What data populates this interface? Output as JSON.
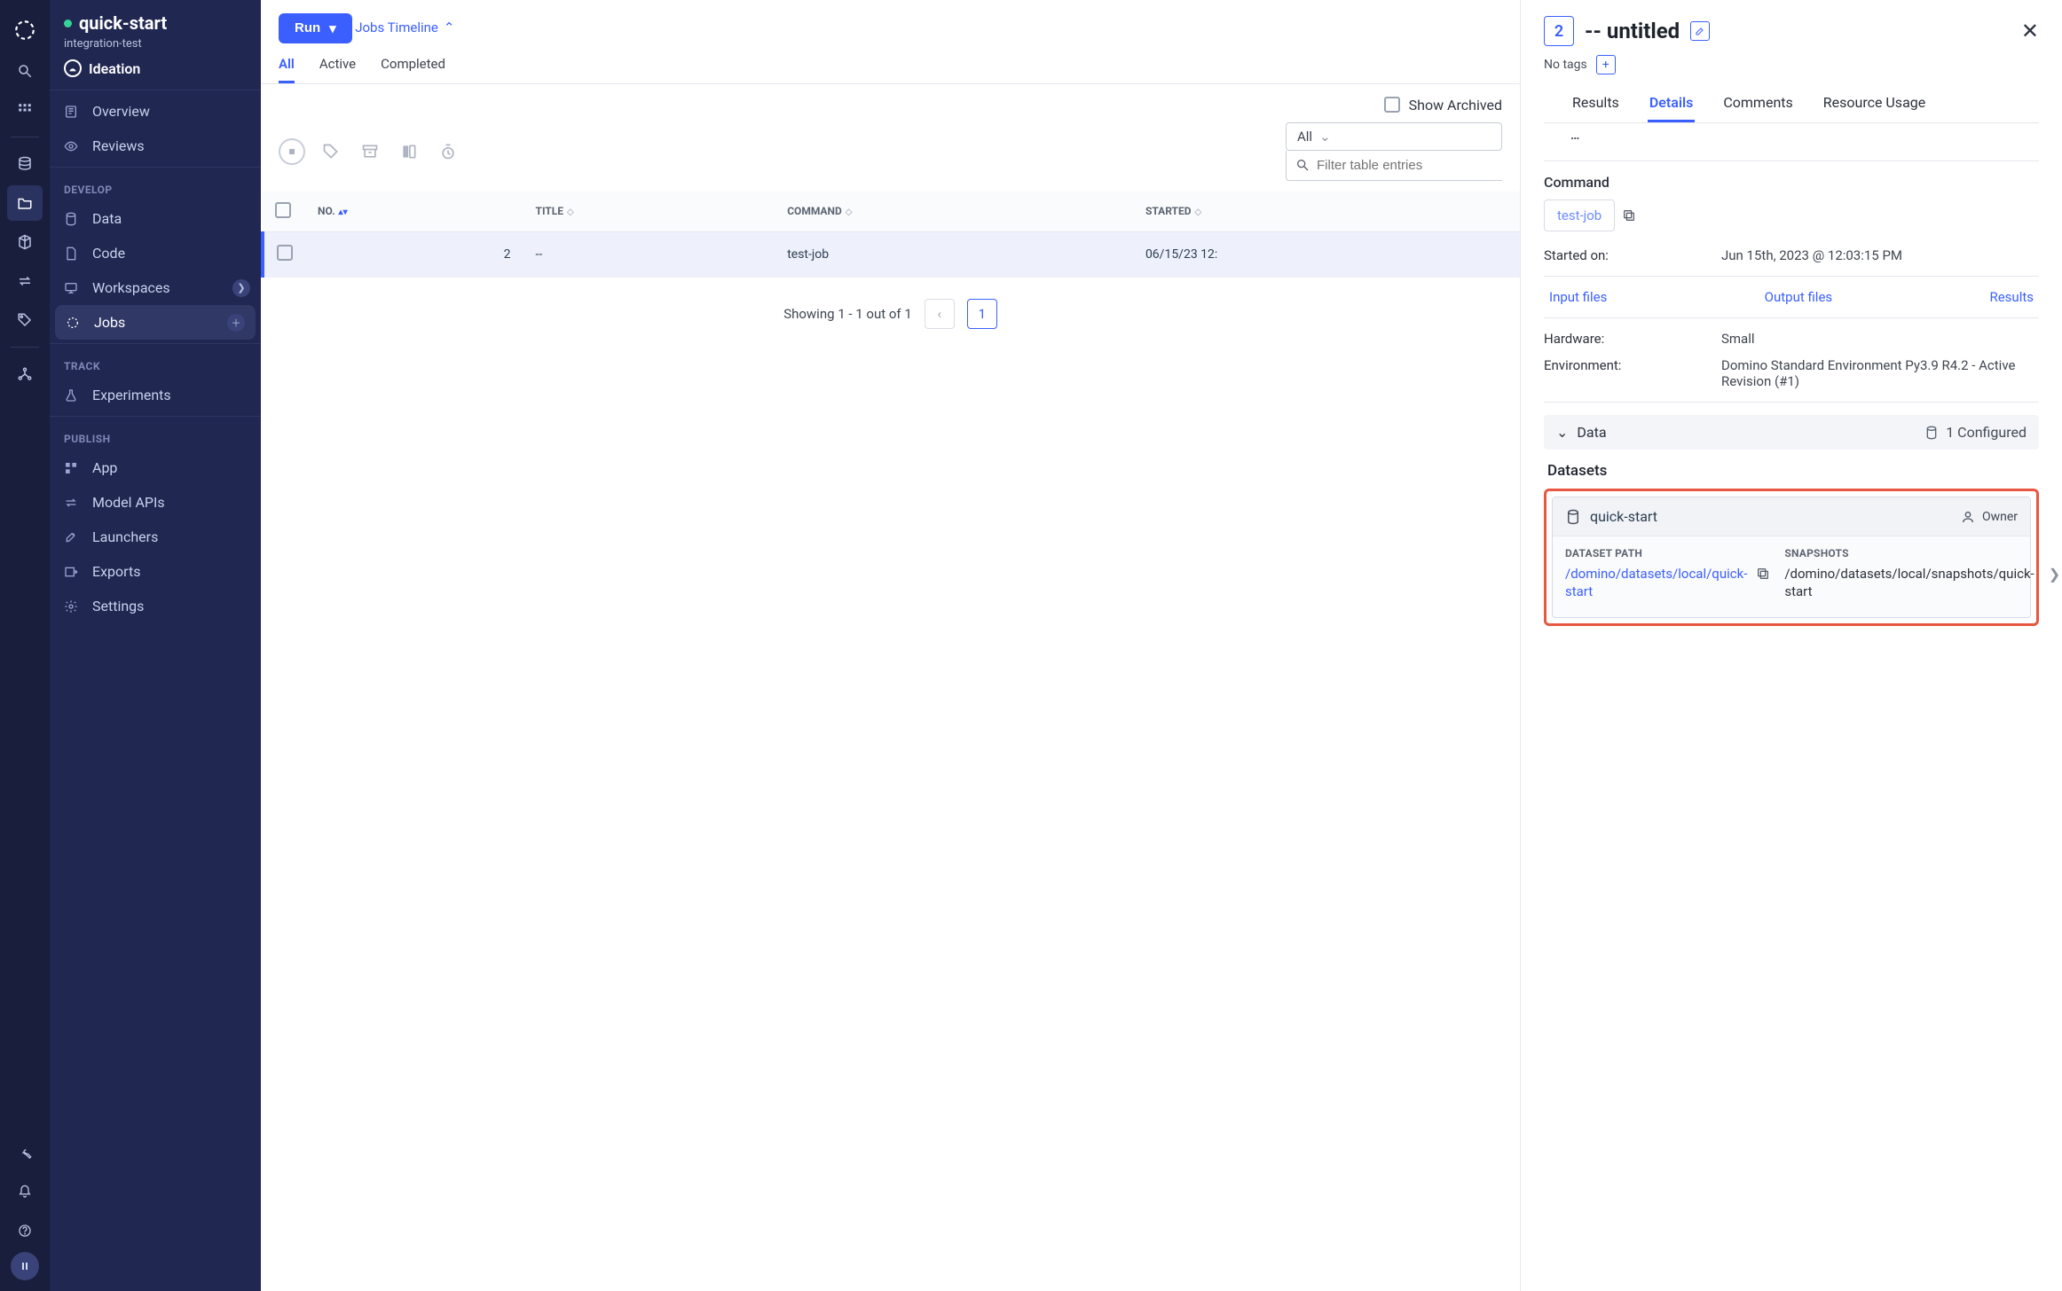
{
  "rail": {
    "icons": [
      "logo",
      "search",
      "apps",
      "data",
      "projects",
      "box",
      "swap",
      "tag",
      "graph"
    ],
    "bottom_icons": [
      "wrench",
      "bell",
      "help",
      "pause"
    ]
  },
  "project": {
    "name": "quick-start",
    "org": "integration-test",
    "stage": "Ideation"
  },
  "sidebar": {
    "sections": {
      "top": [
        {
          "icon": "overview",
          "label": "Overview"
        },
        {
          "icon": "reviews",
          "label": "Reviews"
        }
      ],
      "develop_label": "DEVELOP",
      "develop": [
        {
          "icon": "data",
          "label": "Data"
        },
        {
          "icon": "code",
          "label": "Code"
        },
        {
          "icon": "workspaces",
          "label": "Workspaces",
          "chev": true
        },
        {
          "icon": "jobs",
          "label": "Jobs",
          "active": true,
          "plus": true
        }
      ],
      "track_label": "TRACK",
      "track": [
        {
          "icon": "exp",
          "label": "Experiments"
        }
      ],
      "publish_label": "PUBLISH",
      "publish": [
        {
          "icon": "app",
          "label": "App"
        },
        {
          "icon": "api",
          "label": "Model APIs"
        },
        {
          "icon": "launch",
          "label": "Launchers"
        },
        {
          "icon": "export",
          "label": "Exports"
        },
        {
          "icon": "settings",
          "label": "Settings"
        }
      ]
    }
  },
  "jobs": {
    "run_label": "Run",
    "timeline_label": "Jobs Timeline",
    "tabs": [
      "All",
      "Active",
      "Completed"
    ],
    "active_tab": "All",
    "show_archived_label": "Show Archived",
    "filter_dropdown": "All",
    "search_placeholder": "Filter table entries",
    "columns": [
      "NO.",
      "TITLE",
      "COMMAND",
      "STARTED"
    ],
    "rows": [
      {
        "no": "2",
        "title": "--",
        "command": "test-job",
        "started": "06/15/23 12:"
      }
    ],
    "pager_text": "Showing 1 - 1 out of 1",
    "page": "1"
  },
  "details": {
    "job_no": "2",
    "title": "-- untitled",
    "no_tags": "No tags",
    "tabs": [
      "Results",
      "Details",
      "Comments",
      "Resource Usage"
    ],
    "active_tab": "Details",
    "command_label": "Command",
    "command_value": "test-job",
    "started_label": "Started on:",
    "started_value": "Jun 15th, 2023 @ 12:03:15 PM",
    "links": {
      "input": "Input files",
      "output": "Output files",
      "results": "Results"
    },
    "hardware_label": "Hardware:",
    "hardware_value": "Small",
    "env_label": "Environment:",
    "env_value": "Domino Standard Environment Py3.9 R4.2 - Active Revision (#1)",
    "data_section": {
      "title": "Data",
      "configured": "1 Configured"
    },
    "datasets_title": "Datasets",
    "dataset": {
      "name": "quick-start",
      "role": "Owner",
      "path_label": "DATASET PATH",
      "path": "/domino/datasets/local/quick-start",
      "snap_label": "SNAPSHOTS",
      "snap": "/domino/datasets/local/snapshots/quick-start"
    }
  }
}
